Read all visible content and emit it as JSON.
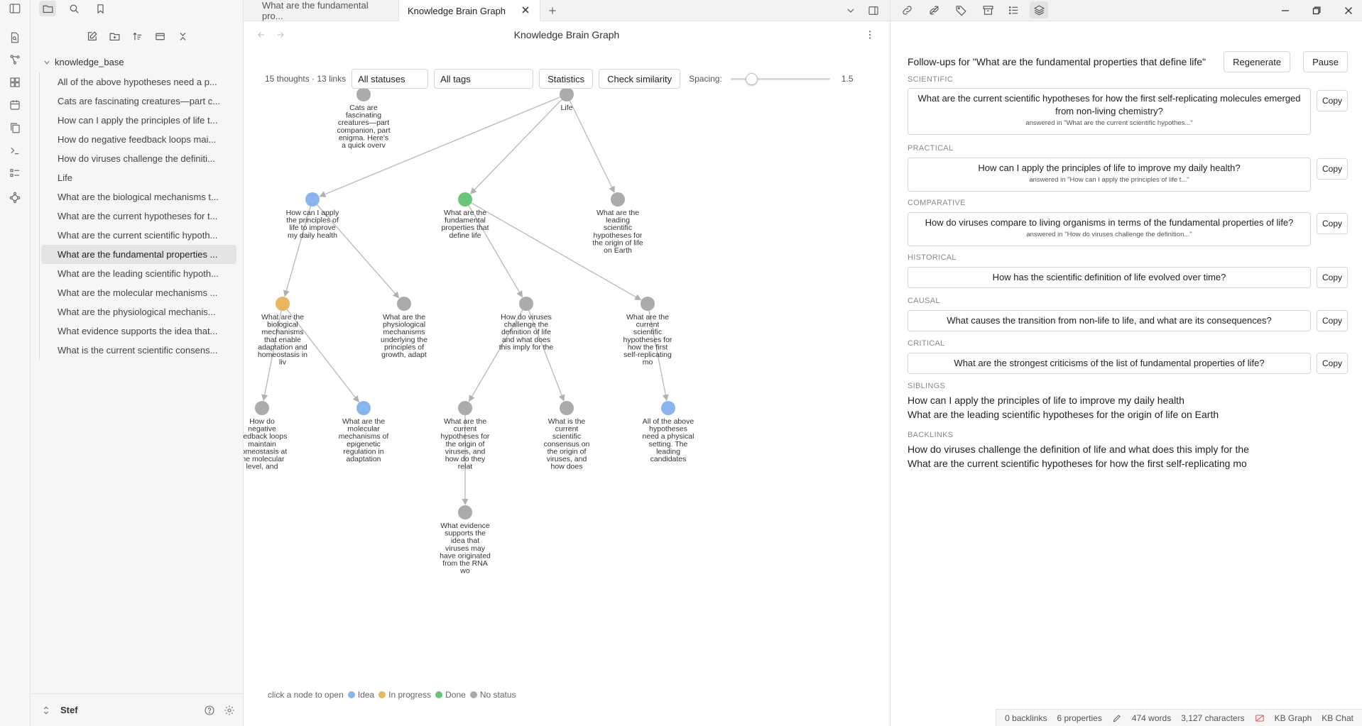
{
  "tabs": {
    "tab1_label": "What are the fundamental pro...",
    "tab2_label": "Knowledge Brain Graph"
  },
  "sidebar": {
    "folder": "knowledge_base",
    "files": [
      "All of the above hypotheses need a p...",
      "Cats are fascinating creatures—part c...",
      "How can I apply the principles of life t...",
      "How do negative feedback loops mai...",
      "How do viruses challenge the definiti...",
      "Life",
      "What are the biological mechanisms t...",
      "What are the current hypotheses for t...",
      "What are the current scientific hypoth...",
      "What are the fundamental properties ...",
      "What are the leading scientific hypoth...",
      "What are the molecular mechanisms ...",
      "What are the physiological mechanis...",
      "What evidence supports the idea that...",
      "What is the current scientific consens..."
    ],
    "active_index": 9,
    "user": "Stef"
  },
  "graph": {
    "title": "Knowledge Brain Graph",
    "stats": "15 thoughts · 13 links",
    "status_filter": "All statuses",
    "tag_filter": "All tags",
    "statistics_label": "Statistics",
    "similarity_label": "Check similarity",
    "spacing_label": "Spacing:",
    "spacing_value": "1.5",
    "spacing_fraction": 0.17,
    "colors": {
      "idea": "#8ab4ee",
      "progress": "#e8b560",
      "done": "#6cc47a",
      "none": "#ababab",
      "edge": "#b8b8b8"
    },
    "nodes": [
      {
        "id": "cats",
        "status": "none",
        "label": [
          "Cats are",
          "fascinating",
          "creatures—part",
          "companion, part",
          "enigma. Here's",
          "a quick overv"
        ]
      },
      {
        "id": "life",
        "status": "none",
        "label": [
          "Life"
        ]
      },
      {
        "id": "apply",
        "status": "idea",
        "label": [
          "How can I apply",
          "the principles of",
          "life to improve",
          "my daily health"
        ]
      },
      {
        "id": "fund",
        "status": "done",
        "label": [
          "What are the",
          "fundamental",
          "properties that",
          "define life"
        ]
      },
      {
        "id": "leading",
        "status": "none",
        "label": [
          "What are the",
          "leading",
          "scientific",
          "hypotheses for",
          "the origin of life",
          "on Earth"
        ]
      },
      {
        "id": "bio",
        "status": "progress",
        "label": [
          "What are the",
          "biological",
          "mechanisms",
          "that enable",
          "adaptation and",
          "homeostasis in",
          "liv"
        ]
      },
      {
        "id": "phys",
        "status": "none",
        "label": [
          "What are the",
          "physiological",
          "mechanisms",
          "underlying the",
          "principles of",
          "growth, adapt"
        ]
      },
      {
        "id": "virus",
        "status": "none",
        "label": [
          "How do viruses",
          "challenge the",
          "definition of life",
          "and what does",
          "this imply for the"
        ]
      },
      {
        "id": "curscihyp",
        "status": "none",
        "label": [
          "What are the",
          "current",
          "scientific",
          "hypotheses for",
          "how the first",
          "self-replicating",
          "mo"
        ]
      },
      {
        "id": "negfb",
        "status": "none",
        "label": [
          "How do",
          "negative",
          "feedback loops",
          "maintain",
          "homeostasis at",
          "the molecular",
          "level, and"
        ]
      },
      {
        "id": "mol",
        "status": "idea",
        "label": [
          "What are the",
          "molecular",
          "mechanisms of",
          "epigenetic",
          "regulation in",
          "adaptation"
        ]
      },
      {
        "id": "curhyp",
        "status": "none",
        "label": [
          "What are the",
          "current",
          "hypotheses for",
          "the origin of",
          "viruses, and",
          "how do they",
          "relat"
        ]
      },
      {
        "id": "consensus",
        "status": "none",
        "label": [
          "What is the",
          "current",
          "scientific",
          "consensus on",
          "the origin of",
          "viruses, and",
          "how does"
        ]
      },
      {
        "id": "allabove",
        "status": "idea",
        "label": [
          "All of the above",
          "hypotheses",
          "need a physical",
          "setting. The",
          "leading",
          "candidates"
        ]
      },
      {
        "id": "evidence",
        "status": "none",
        "label": [
          "What evidence",
          "supports the",
          "idea that",
          "viruses may",
          "have originated",
          "from the RNA",
          "wo"
        ]
      }
    ],
    "edges": [
      [
        "life",
        "apply"
      ],
      [
        "life",
        "fund"
      ],
      [
        "life",
        "leading"
      ],
      [
        "apply",
        "bio"
      ],
      [
        "apply",
        "phys"
      ],
      [
        "fund",
        "virus"
      ],
      [
        "fund",
        "curscihyp"
      ],
      [
        "bio",
        "negfb"
      ],
      [
        "bio",
        "mol"
      ],
      [
        "virus",
        "curhyp"
      ],
      [
        "virus",
        "consensus"
      ],
      [
        "curscihyp",
        "allabove"
      ],
      [
        "curhyp",
        "evidence"
      ]
    ],
    "legend": {
      "hint": "click a node to open",
      "idea": "Idea",
      "progress": "In progress",
      "done": "Done",
      "none": "No status"
    }
  },
  "followups": {
    "title": "Follow-ups for \"What are the fundamental properties that define life\"",
    "regenerate": "Regenerate",
    "pause": "Pause",
    "copy": "Copy",
    "categories": [
      {
        "name": "SCIENTIFIC",
        "question": "What are the current scientific hypotheses for how the first self-replicating molecules emerged from non-living chemistry?",
        "answered": "answered in \"What are the current scientific hypothes...\""
      },
      {
        "name": "PRACTICAL",
        "question": "How can I apply the principles of life to improve my daily health?",
        "answered": "answered in \"How can I apply the principles of life t...\""
      },
      {
        "name": "COMPARATIVE",
        "question": "How do viruses compare to living organisms in terms of the fundamental properties of life?",
        "answered": "answered in \"How do viruses challenge the definition...\""
      },
      {
        "name": "HISTORICAL",
        "question": "How has the scientific definition of life evolved over time?",
        "answered": ""
      },
      {
        "name": "CAUSAL",
        "question": "What causes the transition from non-life to life, and what are its consequences?",
        "answered": ""
      },
      {
        "name": "CRITICAL",
        "question": "What are the strongest criticisms of the list of fundamental properties of life?",
        "answered": ""
      }
    ],
    "siblings_label": "SIBLINGS",
    "siblings": [
      "How can I apply the principles of life to improve my daily health",
      "What are the leading scientific hypotheses for the origin of life on Earth"
    ],
    "backlinks_label": "BACKLINKS",
    "backlinks": [
      "How do viruses challenge the definition of life and what does this imply for the",
      "What are the current scientific hypotheses for how the first self-replicating mo"
    ]
  },
  "status_bar": {
    "backlinks": "0 backlinks",
    "properties": "6 properties",
    "words": "474 words",
    "characters": "3,127 characters",
    "kb_graph": "KB Graph",
    "kb_chat": "KB Chat"
  }
}
